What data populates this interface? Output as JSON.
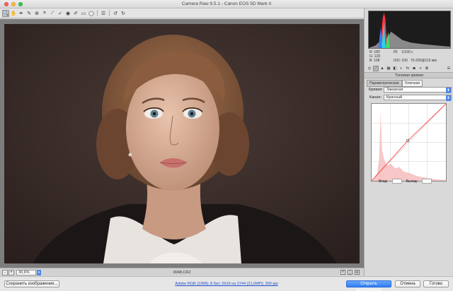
{
  "window": {
    "title": "Camera Raw 9.5.1  -  Canon EOS 5D Mark II"
  },
  "toolbar": {
    "tools": [
      {
        "name": "zoom-tool",
        "glyph": "🔍",
        "active": true
      },
      {
        "name": "hand-tool",
        "glyph": "✋"
      },
      {
        "name": "white-balance-tool",
        "glyph": "✒"
      },
      {
        "name": "color-sampler-tool",
        "glyph": "✎"
      },
      {
        "name": "targeted-adjustment-tool",
        "glyph": "⊕"
      },
      {
        "name": "crop-tool",
        "glyph": "⌗"
      },
      {
        "name": "straighten-tool",
        "glyph": "⟋"
      },
      {
        "name": "spot-removal-tool",
        "glyph": "✓"
      },
      {
        "name": "red-eye-tool",
        "glyph": "◉"
      },
      {
        "name": "adjustment-brush-tool",
        "glyph": "✐"
      },
      {
        "name": "graduated-filter-tool",
        "glyph": "▭"
      },
      {
        "name": "radial-filter-tool",
        "glyph": "◯"
      },
      {
        "name": "preferences-tool",
        "glyph": "☰"
      },
      {
        "name": "rotate-ccw-tool",
        "glyph": "↺"
      },
      {
        "name": "rotate-cw-tool",
        "glyph": "↻"
      }
    ]
  },
  "status": {
    "zoom_value": "30,6%",
    "zoom_minus": "-",
    "zoom_plus": "+",
    "filename": "0048.CR2"
  },
  "readout": {
    "r": "R:   180",
    "g": "G:   129",
    "b": "B:   108",
    "aperture": "f/5",
    "shutter": "1/160 с",
    "iso": "ISO: 100",
    "lens": "70-200@115 мм"
  },
  "panel": {
    "title": "Тоновая кривая",
    "tabs": [
      "Параметрическая",
      "Точечная"
    ],
    "curve_label": "Кривая:",
    "curve_value": "Заказная",
    "channel_label": "Канал:",
    "channel_value": "Красный",
    "input_label": "Вход:",
    "output_label": "Выход:"
  },
  "actions": {
    "save_label": "Сохранить изображение...",
    "workflow_link": "Adobe RGB (1998); 8 бит; 5616 на 3744 (21,0МП); 300 ppi",
    "open_label": "Открыть изображение",
    "cancel_label": "Отмена",
    "done_label": "Готово"
  },
  "colors": {
    "accent": "#2f7df4",
    "curve_line": "#ff3b3b",
    "histogram_fill": "#f7c6c6"
  }
}
